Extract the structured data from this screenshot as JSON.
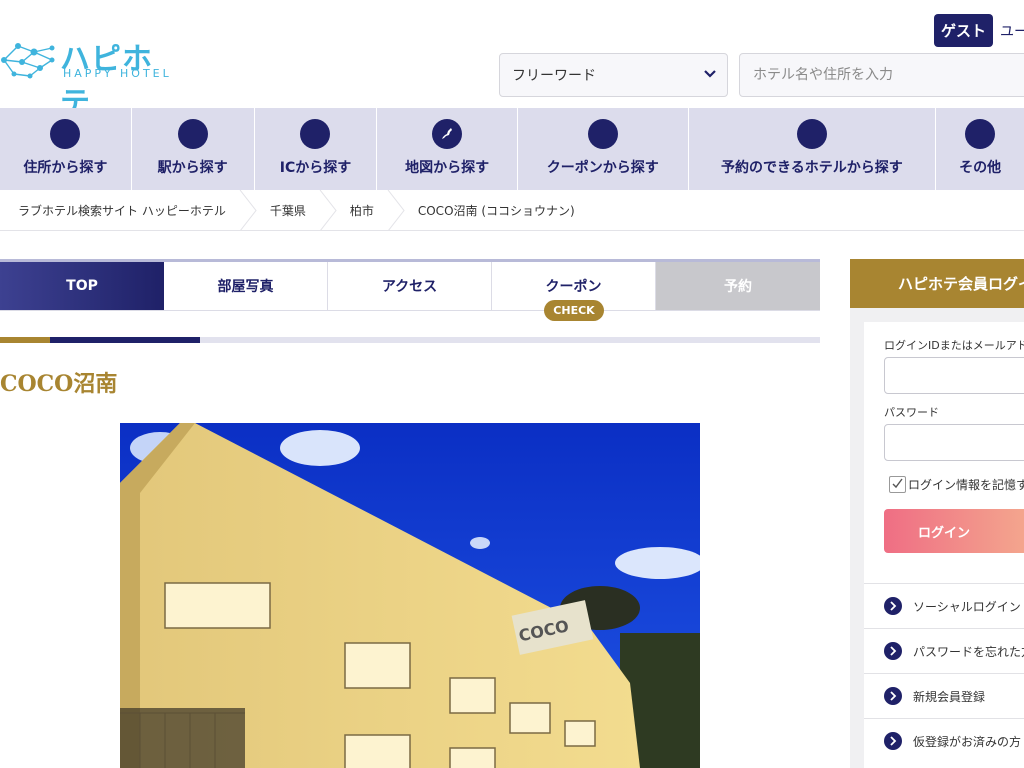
{
  "header": {
    "logo_jp": "ハピホテ",
    "logo_en": "HAPPY HOTEL",
    "guest_badge": "ゲスト",
    "user_text": "ユー",
    "select_value": "フリーワード",
    "search_placeholder": "ホテル名や住所を入力"
  },
  "nav": {
    "items": [
      {
        "label": "住所から探す",
        "icon": "circle-icon"
      },
      {
        "label": "駅から探す",
        "icon": "circle-icon"
      },
      {
        "label": "ICから探す",
        "icon": "circle-icon"
      },
      {
        "label": "地図から探す",
        "icon": "japan-map-icon"
      },
      {
        "label": "クーポンから探す",
        "icon": "circle-icon"
      },
      {
        "label": "予約のできるホテルから探す",
        "icon": "circle-icon"
      },
      {
        "label": "その他",
        "icon": "circle-icon"
      }
    ]
  },
  "breadcrumb": {
    "items": [
      "ラブホテル検索サイト ハッピーホテル",
      "千葉県",
      "柏市",
      "COCO沼南 (ココショウナン)"
    ]
  },
  "tabs": {
    "items": [
      "TOP",
      "部屋写真",
      "アクセス",
      "クーポン",
      "予約"
    ],
    "check_badge": "CHECK"
  },
  "progress": {
    "fraction": 0.24
  },
  "hotel": {
    "title": "COCO沼南",
    "sign_text": "COCO"
  },
  "login": {
    "heading": "ハピホテ会員ログイン",
    "id_label": "ログインIDまたはメールアドレス",
    "password_label": "パスワード",
    "remember_label": "ログイン情報を記憶する",
    "login_button": "ログイン",
    "links": [
      "ソーシャルログイン",
      "パスワードを忘れた方",
      "新規会員登録",
      "仮登録がお済みの方"
    ]
  },
  "colors": {
    "navy": "#1f2168",
    "gold": "#a88531",
    "nav_bg": "#dcdcec",
    "logo_blue": "#3fb4dd"
  }
}
